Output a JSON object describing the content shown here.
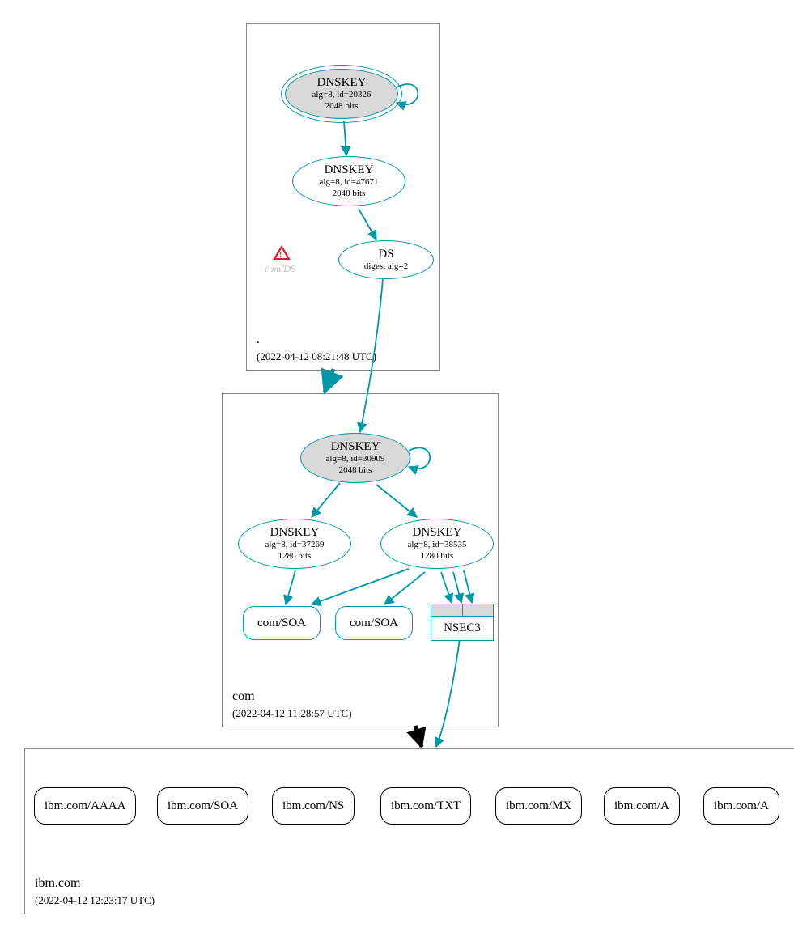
{
  "zones": {
    "root": {
      "name": ".",
      "timestamp": "(2022-04-12 08:21:48 UTC)"
    },
    "com": {
      "name": "com",
      "timestamp": "(2022-04-12 11:28:57 UTC)"
    },
    "ibmcom": {
      "name": "ibm.com",
      "timestamp": "(2022-04-12 12:23:17 UTC)"
    }
  },
  "nodes": {
    "root_ksk": {
      "title": "DNSKEY",
      "line1": "alg=8, id=20326",
      "line2": "2048 bits"
    },
    "root_zsk": {
      "title": "DNSKEY",
      "line1": "alg=8, id=47671",
      "line2": "2048 bits"
    },
    "ds_com": {
      "title": "DS",
      "line1": "digest alg=2"
    },
    "com_ksk": {
      "title": "DNSKEY",
      "line1": "alg=8, id=30909",
      "line2": "2048 bits"
    },
    "com_zsk1": {
      "title": "DNSKEY",
      "line1": "alg=8, id=37269",
      "line2": "1280 bits"
    },
    "com_zsk2": {
      "title": "DNSKEY",
      "line1": "alg=8, id=38535",
      "line2": "1280 bits"
    },
    "com_soa1": {
      "label": "com/SOA"
    },
    "com_soa2": {
      "label": "com/SOA"
    },
    "nsec3": {
      "label": "NSEC3"
    },
    "warn": {
      "label": "com/DS"
    }
  },
  "records": {
    "aaaa": "ibm.com/AAAA",
    "soa": "ibm.com/SOA",
    "ns": "ibm.com/NS",
    "txt": "ibm.com/TXT",
    "mx": "ibm.com/MX",
    "a1": "ibm.com/A",
    "a2": "ibm.com/A"
  }
}
